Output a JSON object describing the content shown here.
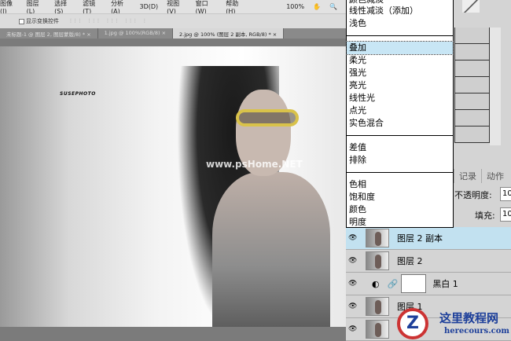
{
  "menubar": [
    "图像(I)",
    "图层(L)",
    "选择(S)",
    "滤镜(T)",
    "分析(A)",
    "3D(D)",
    "视图(V)",
    "窗口(W)",
    "帮助(H)",
    "100%"
  ],
  "options": {
    "checkbox_label": "显示变换控件"
  },
  "tabs": [
    "未标题-1 @ 图层 2, 图层蒙版/8) *",
    "1.jpg @ 100%(RGB/8)",
    "2.jpg @ 100% (图层 2 副本, RGB/8) *"
  ],
  "canvas": {
    "brand": "SUSEPHOTO",
    "watermark": "www.psHome.NET"
  },
  "blend_menu": {
    "partial_top": "颜色减淡",
    "groups": [
      [
        "线性减淡（添加）",
        "浅色"
      ],
      [
        "叠加",
        "柔光",
        "强光",
        "亮光",
        "线性光",
        "点光",
        "实色混合"
      ],
      [
        "差值",
        "排除"
      ],
      [
        "色相",
        "饱和度",
        "颜色",
        "明度"
      ]
    ],
    "selected": "叠加"
  },
  "panel": {
    "tabs": [
      "记录",
      "动作"
    ],
    "opacity_label": "不透明度:",
    "opacity_value": "10",
    "fill_label": "填充:",
    "fill_value": "10"
  },
  "layers": [
    {
      "name": "图层 2 副本",
      "selected": true
    },
    {
      "name": "图层 2"
    },
    {
      "name": "黑白 1",
      "adjustment": true
    },
    {
      "name": "图层 1"
    },
    {
      "name": ""
    }
  ],
  "logo": {
    "title": "这里教程网",
    "url": "herecours.com"
  }
}
